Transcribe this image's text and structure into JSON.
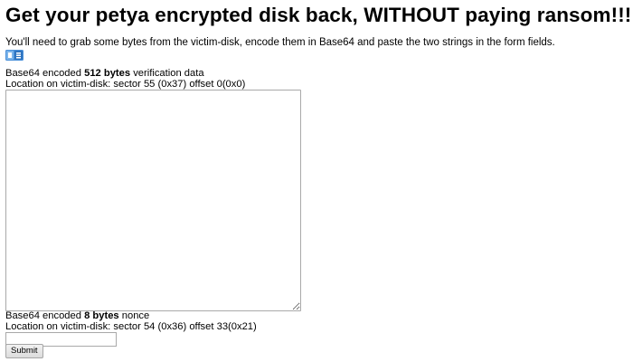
{
  "page": {
    "title": "Get your petya encrypted disk back, WITHOUT paying ransom!!!",
    "intro": "You'll need to grab some bytes from the victim-disk, encode them in Base64 and paste the two strings in the form fields."
  },
  "icons": {
    "flag": "language-flag-icon"
  },
  "verification": {
    "label_prefix": "Base64 encoded ",
    "label_bold": "512 bytes",
    "label_suffix": " verification data",
    "location": "Location on victim-disk: sector 55 (0x37) offset 0(0x0)",
    "value": ""
  },
  "nonce": {
    "label_prefix": "Base64 encoded ",
    "label_bold": "8 bytes",
    "label_suffix": " nonce",
    "location": "Location on victim-disk: sector 54 (0x36) offset 33(0x21)",
    "value": ""
  },
  "form": {
    "submit_label": "Submit"
  },
  "colors": {
    "flag_blue": "#4a90d9",
    "flag_white": "#ffffff"
  }
}
